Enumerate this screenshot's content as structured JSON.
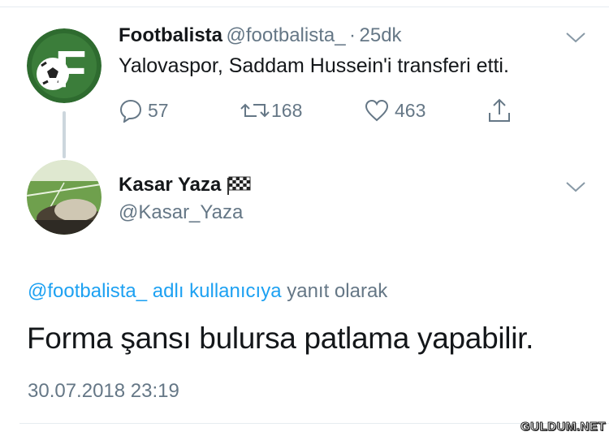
{
  "tweet": {
    "author_name": "Footbalista",
    "author_handle": "@footbalista_",
    "separator": "·",
    "time": "25dk",
    "text": "Yalovaspor, Saddam Hussein'i transferi etti.",
    "replies": "57",
    "retweets": "168",
    "likes": "463",
    "avatar_letter": "F"
  },
  "reply": {
    "author_name": "Kasar Yaza",
    "author_handle": "@Kasar_Yaza",
    "context_link": "@footbalista_ adlı kullanıcıya",
    "context_suffix": "yanıt olarak",
    "text": "Forma şansı bulursa patlama yapabilir.",
    "timestamp": "30.07.2018 23:19"
  },
  "watermark": "GULDUM.NET",
  "colors": {
    "accent": "#1da1f2",
    "muted": "#657786",
    "avatar_green": "#2e6b2f"
  }
}
